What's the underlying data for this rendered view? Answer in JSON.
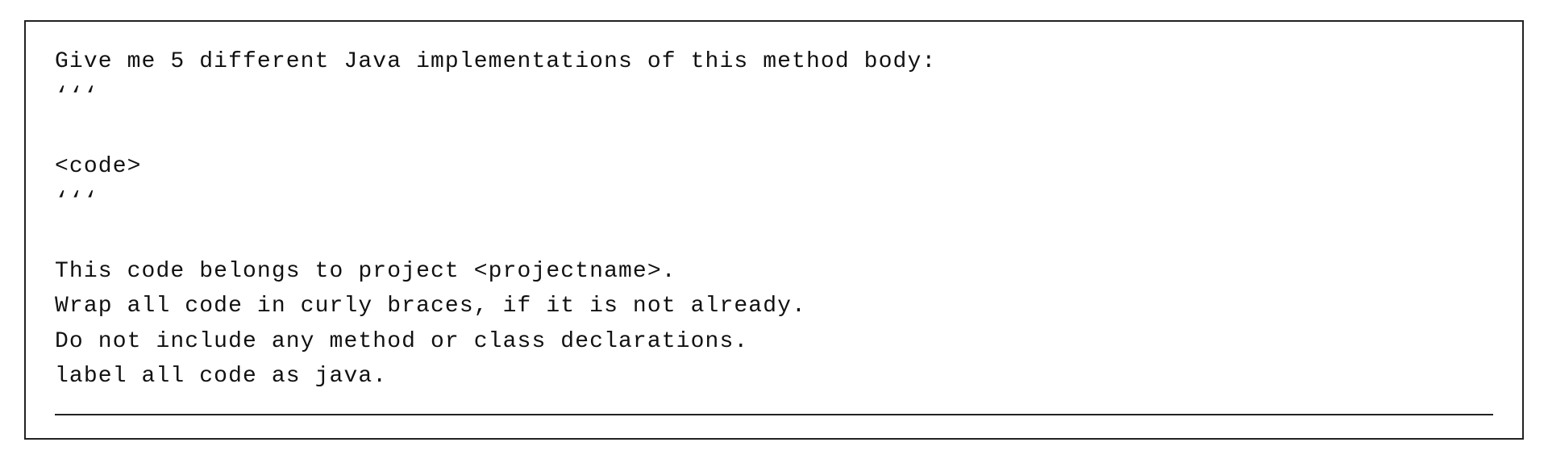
{
  "card": {
    "lines": [
      "Give me 5 different Java implementations of this method body:",
      "‘‘‘",
      "",
      "<code>",
      "‘‘‘",
      "",
      "This code belongs to project <projectname>.",
      "Wrap all code in curly braces, if it is not already.",
      "Do not include any method or class declarations.",
      "label all code as java."
    ]
  }
}
